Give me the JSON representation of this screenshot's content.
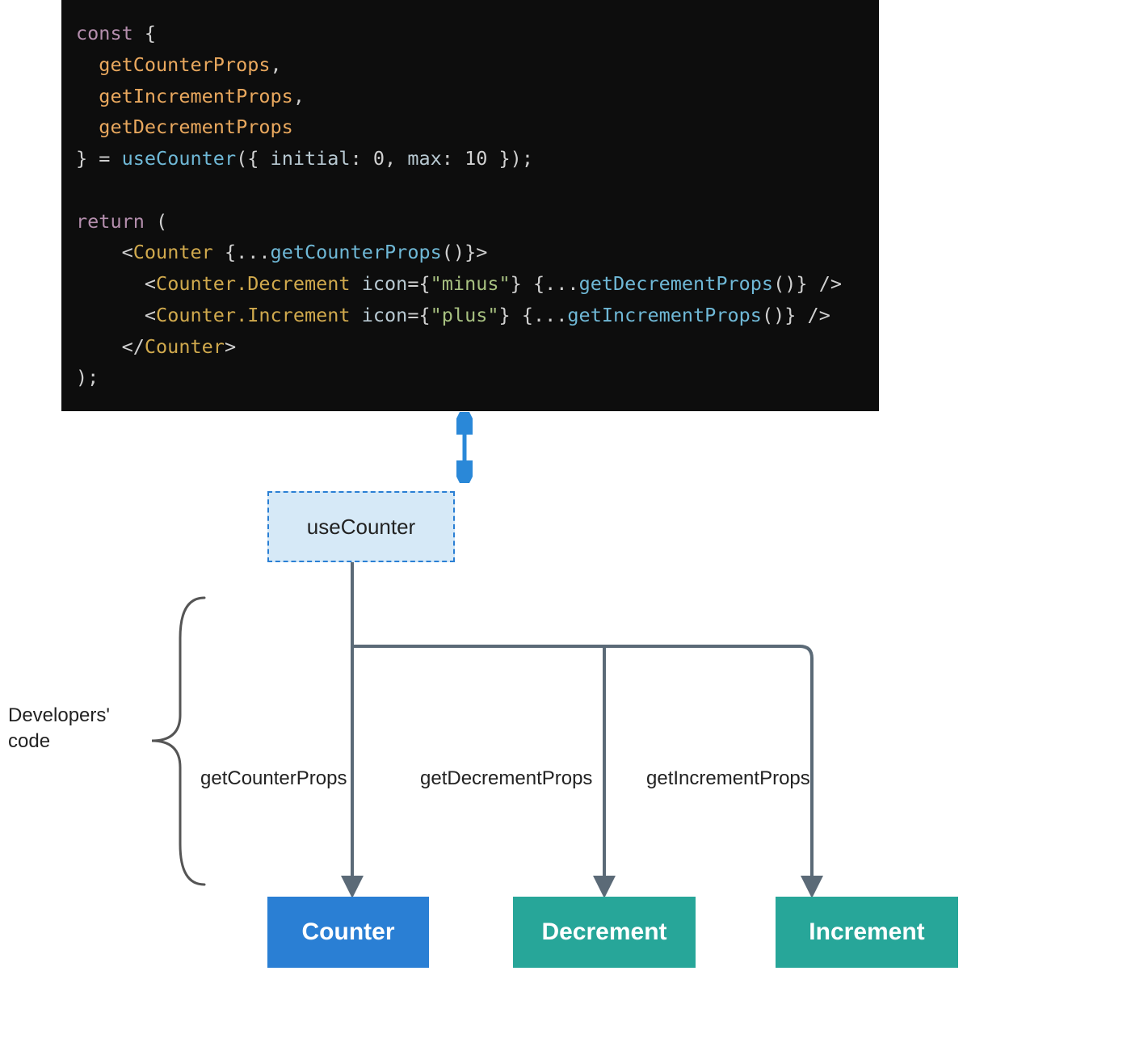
{
  "code": {
    "kw_const": "const",
    "brace_open": "{",
    "id_getCounterProps": "getCounterProps",
    "id_getIncrementProps": "getIncrementProps",
    "id_getDecrementProps": "getDecrementProps",
    "kw_eq": "=",
    "fn_useCounter": "useCounter",
    "args_open": "({",
    "arg_initial_k": "initial",
    "arg_initial_v": "0",
    "arg_max_k": "max",
    "arg_max_v": "10",
    "args_close": "});",
    "kw_return": "return",
    "paren_open": "(",
    "tag_counter": "Counter",
    "spread_open": "{...",
    "call_getCounterProps": "getCounterProps",
    "spread_close": "()}",
    "tag_counter_dec": "Counter.Decrement",
    "attr_icon": "icon",
    "str_minus": "\"minus\"",
    "call_getDecrementProps": "getDecrementProps",
    "tag_counter_inc": "Counter.Increment",
    "str_plus": "\"plus\"",
    "call_getIncrementProps": "getIncrementProps",
    "self_close": "/>",
    "close_tag_counter": "Counter",
    "paren_close": ");"
  },
  "diagram": {
    "hook_box": "useCounter",
    "dev_label_line1": "Developers'",
    "dev_label_line2": "code",
    "edge_getCounterProps": "getCounterProps",
    "edge_getDecrementProps": "getDecrementProps",
    "edge_getIncrementProps": "getIncrementProps",
    "box_counter": "Counter",
    "box_decrement": "Decrement",
    "box_increment": "Increment"
  },
  "colors": {
    "code_bg": "#0d0d0d",
    "hook_bg": "#d6e9f7",
    "hook_border": "#2a7fd4",
    "box_blue": "#2a7fd4",
    "box_teal": "#27a699",
    "connector": "#5b6a77",
    "double_arrow": "#2a88d8"
  }
}
